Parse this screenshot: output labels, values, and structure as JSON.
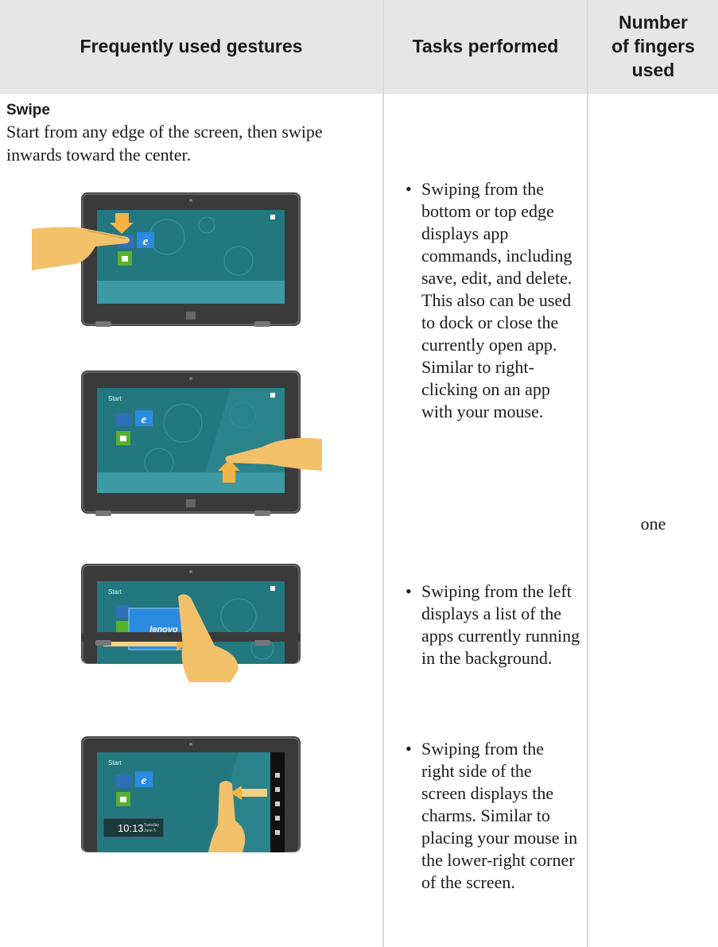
{
  "header": {
    "col_gestures": "Frequently used gestures",
    "col_tasks": "Tasks performed",
    "col_fingers_line1": "Number",
    "col_fingers_line2": "of fingers",
    "col_fingers_line3": "used"
  },
  "gesture": {
    "title": "Swipe",
    "description": "Start from any edge of the screen, then swipe inwards toward the center."
  },
  "tasks": [
    "Swiping from the bottom or top edge displays app commands, including save, edit, and delete. This also can be used to dock or close the currently open app. Similar to right-clicking on an app with your mouse.",
    "Swiping from the left displays a list of the apps currently running in the background.",
    "Swiping from the right side of the screen displays the charms. Similar to placing your mouse in the lower-right corner of the screen."
  ],
  "fingers_used": "one",
  "screen": {
    "start_label": "Start",
    "lenovo_label": "lenovo",
    "clock_time": "10:13",
    "clock_day": "Tuesday",
    "clock_date": "June 5"
  }
}
